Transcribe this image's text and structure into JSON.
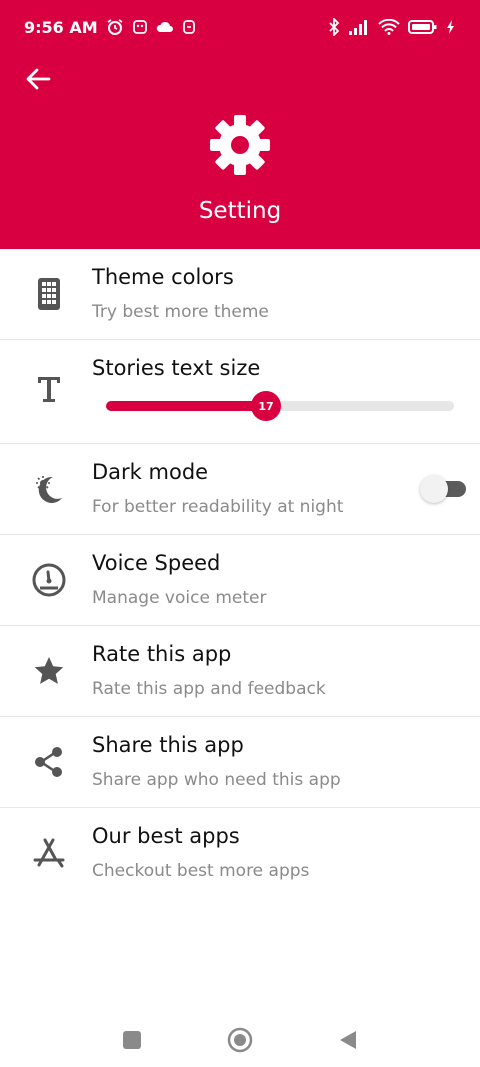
{
  "status_bar": {
    "time": "9:56 AM"
  },
  "header": {
    "title": "Setting",
    "bg_color": "#d90042"
  },
  "settings": {
    "theme": {
      "title": "Theme colors",
      "subtitle": "Try best more theme",
      "icon": "palette-grid-icon"
    },
    "text_size": {
      "title": "Stories text size",
      "value": "17",
      "fraction": 0.46,
      "icon": "text-size-icon"
    },
    "dark_mode": {
      "title": "Dark mode",
      "subtitle": "For better readability at night",
      "enabled": false,
      "icon": "moon-icon"
    },
    "voice_speed": {
      "title": "Voice Speed",
      "subtitle": "Manage voice meter",
      "icon": "speedometer-icon"
    },
    "rate": {
      "title": "Rate this app",
      "subtitle": "Rate this app and feedback",
      "icon": "star-icon"
    },
    "share": {
      "title": "Share this app",
      "subtitle": "Share app who need this app",
      "icon": "share-icon"
    },
    "more_apps": {
      "title": "Our best apps",
      "subtitle": "Checkout best more apps",
      "icon": "app-store-icon"
    }
  },
  "accent_color": "#d90042"
}
